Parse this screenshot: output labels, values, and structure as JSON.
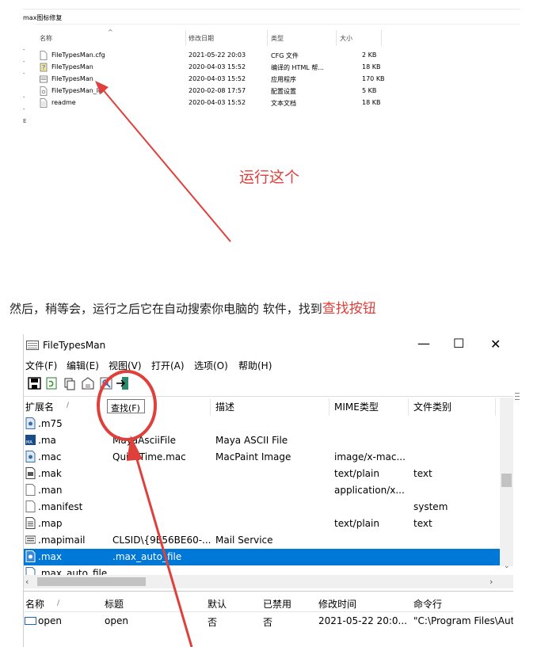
{
  "explorer": {
    "folder_title": "max图标修复",
    "columns": [
      "名称",
      "修改日期",
      "类型",
      "大小"
    ],
    "files": [
      {
        "name": "FileTypesMan.cfg",
        "date": "2021-05-22 20:03",
        "type": "CFG 文件",
        "size": "2 KB",
        "icon": "text-file-icon"
      },
      {
        "name": "FileTypesMan",
        "date": "2020-04-03 15:52",
        "type": "编译的 HTML 帮...",
        "size": "18 KB",
        "icon": "help-file-icon"
      },
      {
        "name": "FileTypesMan",
        "date": "2020-04-03 15:52",
        "type": "应用程序",
        "size": "170 KB",
        "icon": "app-icon"
      },
      {
        "name": "FileTypesMan_lg",
        "date": "2020-02-08 17:57",
        "type": "配置设置",
        "size": "5 KB",
        "icon": "config-file-icon"
      },
      {
        "name": "readme",
        "date": "2020-04-03 15:52",
        "type": "文本文档",
        "size": "18 KB",
        "icon": "text-file-icon"
      }
    ]
  },
  "annotation_run": "运行这个",
  "instruction": {
    "text": "然后，稍等会，运行之后它在自动搜索你电脑的 软件，找到",
    "highlight": "查找按钮"
  },
  "app": {
    "title": "FileTypesMan",
    "window_buttons": {
      "minimize": "—",
      "maximize": "☐",
      "close": "✕"
    },
    "menu": [
      "文件(F)",
      "编辑(E)",
      "视图(V)",
      "打开(A)",
      "选项(O)",
      "帮助(H)"
    ],
    "tooltip": "查找(F)",
    "columns": [
      "扩展名",
      "描述",
      "MIME类型",
      "文件类别"
    ],
    "rows": [
      {
        "ext": ".m75",
        "type": "",
        "desc": "",
        "mime": "",
        "cat": ""
      },
      {
        "ext": ".ma",
        "type": "MayaAsciiFile",
        "desc": "Maya ASCII File",
        "mime": "",
        "cat": ""
      },
      {
        "ext": ".mac",
        "type": "QuickTime.mac",
        "desc": "MacPaint Image",
        "mime": "image/x-mac...",
        "cat": ""
      },
      {
        "ext": ".mak",
        "type": "",
        "desc": "",
        "mime": "text/plain",
        "cat": "text"
      },
      {
        "ext": ".man",
        "type": "",
        "desc": "",
        "mime": "application/x...",
        "cat": ""
      },
      {
        "ext": ".manifest",
        "type": "",
        "desc": "",
        "mime": "",
        "cat": "system"
      },
      {
        "ext": ".map",
        "type": "",
        "desc": "",
        "mime": "text/plain",
        "cat": "text"
      },
      {
        "ext": ".mapimail",
        "type": "CLSID\\{9E56BE60-...",
        "desc": "Mail Service",
        "mime": "",
        "cat": ""
      },
      {
        "ext": ".max",
        "type": ".max_auto_file",
        "desc": "",
        "mime": "",
        "cat": ""
      },
      {
        "ext": ".max_auto_file",
        "type": "",
        "desc": "",
        "mime": "",
        "cat": ""
      }
    ],
    "bottom_columns": [
      "名称",
      "标题",
      "默认",
      "已禁用",
      "修改时间",
      "命令行"
    ],
    "bottom_row": {
      "name": "open",
      "title": "open",
      "default": "否",
      "disabled": "否",
      "modified": "2021-05-22 20:0...",
      "command": "\"C:\\Program Files\\Aut"
    }
  },
  "colors": {
    "annotation": "#e0403b",
    "selection": "#0078d7"
  }
}
